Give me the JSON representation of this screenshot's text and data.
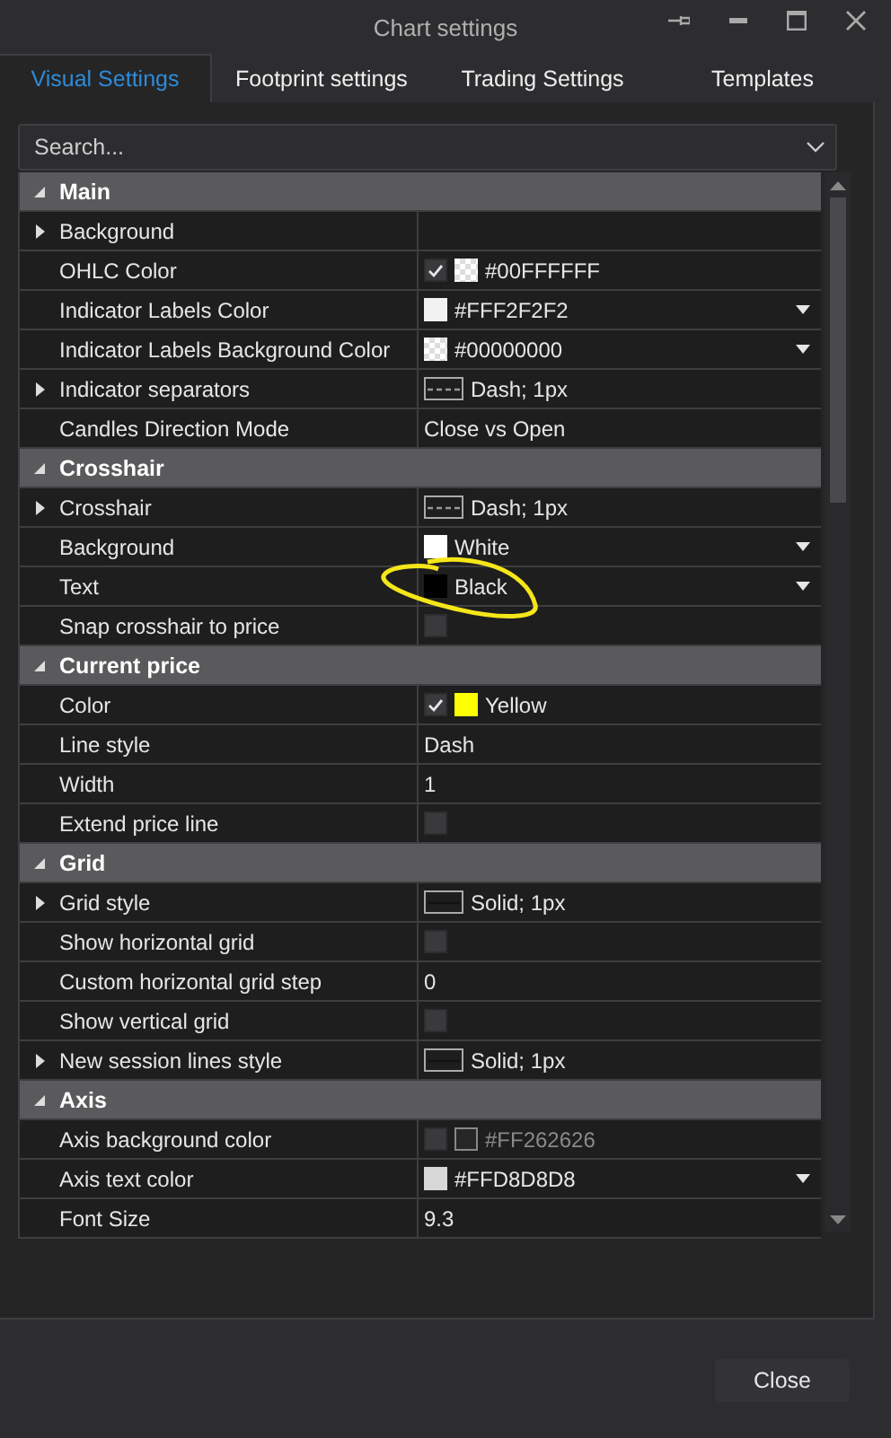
{
  "window": {
    "title": "Chart settings"
  },
  "tabs": [
    {
      "label": "Visual Settings",
      "selected": true
    },
    {
      "label": "Footprint settings",
      "selected": false
    },
    {
      "label": "Trading Settings",
      "selected": false
    },
    {
      "label": "Templates",
      "selected": false
    }
  ],
  "search": {
    "placeholder": "Search..."
  },
  "sections": [
    {
      "title": "Main",
      "expanded": true,
      "rows": [
        {
          "label": "Background",
          "expandable": true,
          "kind": "empty"
        },
        {
          "label": "OHLC Color",
          "kind": "color",
          "checked": true,
          "transparent": true,
          "value": "#00FFFFFF"
        },
        {
          "label": "Indicator Labels Color",
          "kind": "color",
          "color": "#f2f2f2",
          "value": "#FFF2F2F2",
          "dropdown": true
        },
        {
          "label": "Indicator Labels Background Color",
          "kind": "color",
          "transparent": true,
          "value": "#00000000",
          "dropdown": true
        },
        {
          "label": "Indicator separators",
          "expandable": true,
          "kind": "line",
          "dashed": true,
          "value": "Dash; 1px"
        },
        {
          "label": "Candles Direction Mode",
          "kind": "text",
          "value": "Close vs Open"
        }
      ]
    },
    {
      "title": "Crosshair",
      "expanded": true,
      "rows": [
        {
          "label": "Crosshair",
          "expandable": true,
          "kind": "line",
          "dashed": true,
          "value": "Dash; 1px"
        },
        {
          "label": "Background",
          "kind": "color",
          "color": "#ffffff",
          "value": "White",
          "dropdown": true
        },
        {
          "label": "Text",
          "kind": "color",
          "color": "#000000",
          "value": "Black",
          "dropdown": true
        },
        {
          "label": "Snap crosshair to price",
          "kind": "checkbox",
          "checked": false
        }
      ]
    },
    {
      "title": "Current price",
      "expanded": true,
      "rows": [
        {
          "label": "Color",
          "kind": "color",
          "checked": true,
          "color": "#ffff00",
          "value": "Yellow"
        },
        {
          "label": "Line style",
          "kind": "text",
          "value": "Dash"
        },
        {
          "label": "Width",
          "kind": "text",
          "value": "1"
        },
        {
          "label": "Extend price line",
          "kind": "checkbox",
          "checked": false
        }
      ]
    },
    {
      "title": "Grid",
      "expanded": true,
      "rows": [
        {
          "label": "Grid style",
          "expandable": true,
          "kind": "line",
          "dashed": false,
          "value": "Solid; 1px"
        },
        {
          "label": "Show horizontal grid",
          "kind": "checkbox",
          "checked": false
        },
        {
          "label": "Custom horizontal grid step",
          "kind": "text",
          "value": "0"
        },
        {
          "label": "Show vertical grid",
          "kind": "checkbox",
          "checked": false
        },
        {
          "label": "New session lines style",
          "expandable": true,
          "kind": "line",
          "dashed": false,
          "value": "Solid; 1px"
        }
      ]
    },
    {
      "title": "Axis",
      "expanded": true,
      "rows": [
        {
          "label": "Axis background color",
          "kind": "color",
          "checked": false,
          "color": "#262626",
          "value": "#FF262626",
          "disabled": true
        },
        {
          "label": "Axis text color",
          "kind": "color",
          "color": "#d8d8d8",
          "value": "#FFD8D8D8",
          "dropdown": true
        },
        {
          "label": "Font Size",
          "kind": "text",
          "value": "9.3"
        }
      ]
    }
  ],
  "annotation": {
    "kind": "ellipse"
  },
  "buttons": [
    {
      "label": "Close"
    }
  ]
}
